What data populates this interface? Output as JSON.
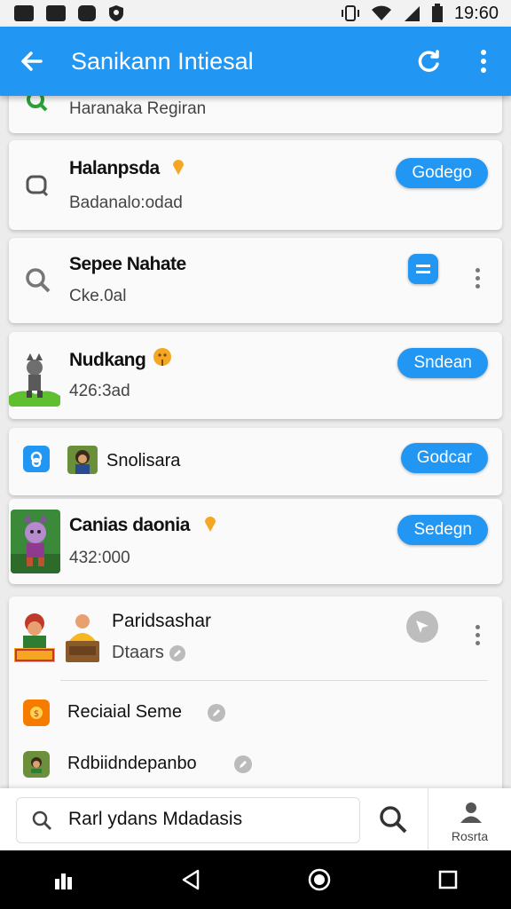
{
  "status_bar": {
    "time": "19:60"
  },
  "app_bar": {
    "title": "Sanikann Intiesal"
  },
  "cards": [
    {
      "subtitle": "Haranaka Regiran"
    },
    {
      "title": "Halanpsda",
      "subtitle": "Badanalo:odad",
      "action": "Godego"
    },
    {
      "title": "Sepee Nahate",
      "subtitle": "Cke.0al"
    },
    {
      "title": "Nudkang",
      "subtitle": "426:3ad",
      "action": "Sndean"
    },
    {
      "title": "Snolisara",
      "action": "Godcar"
    },
    {
      "title": "Canias daonia",
      "subtitle": "432:000",
      "action": "Sedegn"
    },
    {
      "title": "Paridsashar",
      "subtitle": "Dtaars",
      "sub_items": [
        {
          "label": "Reciaial Seme"
        },
        {
          "label": "Rdbiidndepanbo"
        }
      ]
    }
  ],
  "bottom": {
    "search_text": "Rarl ydans Mdadasis",
    "profile_label": "Rosrta"
  },
  "colors": {
    "primary": "#2196f3",
    "accent_orange": "#f5a623"
  },
  "icons": {
    "back": "arrow-left-icon",
    "refresh": "refresh-icon",
    "menu": "more-vert-icon",
    "search": "search-icon",
    "profile": "person-icon"
  }
}
